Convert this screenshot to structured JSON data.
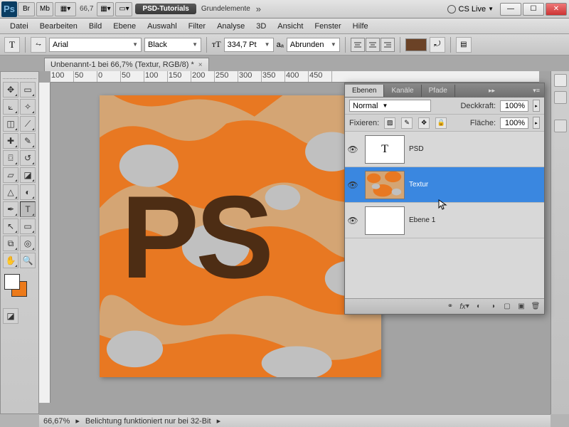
{
  "titlebar": {
    "ps": "Ps",
    "br": "Br",
    "mb": "Mb",
    "zoom": "66,7",
    "pill": "PSD-Tutorials",
    "label": "Grundelemente",
    "cslive": "CS Live"
  },
  "menu": [
    "Datei",
    "Bearbeiten",
    "Bild",
    "Ebene",
    "Auswahl",
    "Filter",
    "Analyse",
    "3D",
    "Ansicht",
    "Fenster",
    "Hilfe"
  ],
  "options": {
    "font": "Arial",
    "weight": "Black",
    "size": "334,7 Pt",
    "aa": "Abrunden",
    "aa_prefix": "aₐ"
  },
  "document": {
    "tab": "Unbenannt-1 bei 66,7% (Textur, RGB/8) *",
    "canvas_text": "PS"
  },
  "ruler": [
    "100",
    "50",
    "0",
    "50",
    "100",
    "150",
    "200",
    "250",
    "300",
    "350",
    "400",
    "450"
  ],
  "panel": {
    "tabs": [
      "Ebenen",
      "Kanäle",
      "Pfade"
    ],
    "blend": "Normal",
    "opacity_lbl": "Deckkraft:",
    "opacity": "100%",
    "fill_lbl": "Fläche:",
    "fill": "100%",
    "lock_lbl": "Fixieren:",
    "layers": [
      {
        "name": "PSD",
        "thumb": "T",
        "selected": false
      },
      {
        "name": "Textur",
        "thumb": "tex",
        "selected": true
      },
      {
        "name": "Ebene 1",
        "thumb": "",
        "selected": false
      }
    ]
  },
  "status": {
    "zoom": "66,67%",
    "msg": "Belichtung funktioniert nur bei 32-Bit"
  }
}
